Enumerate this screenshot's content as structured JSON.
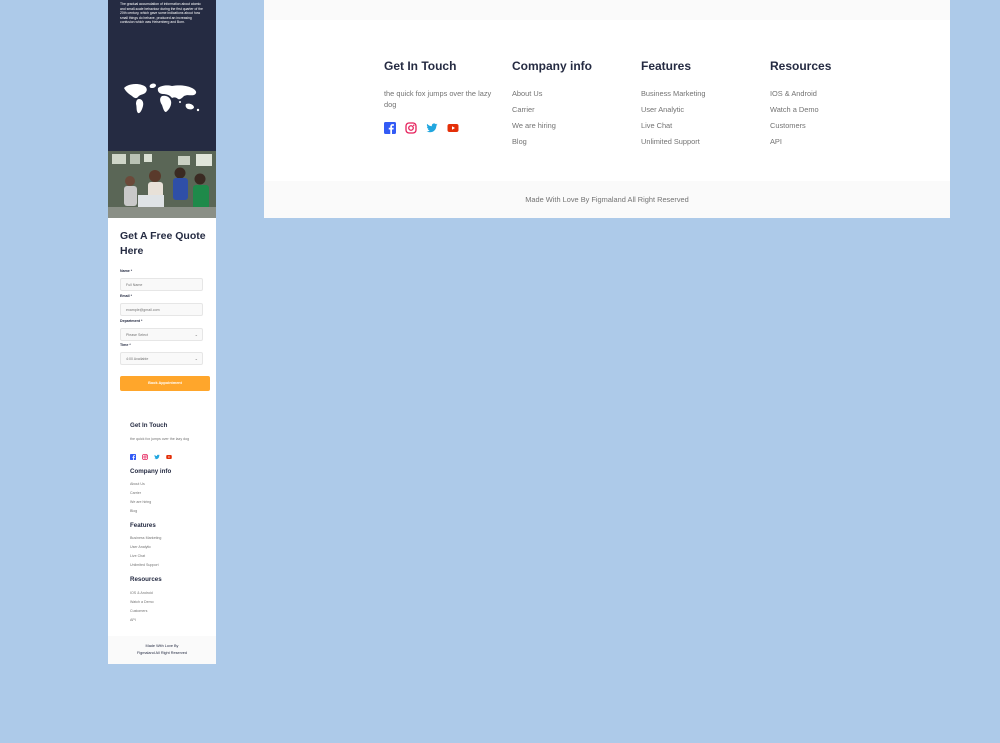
{
  "mobile": {
    "hero_text": "The gradual accumulation of information about atomic and small-scale behaviour during the first quarter of the 20th century, which gave some indications about how small things do behave, produced an increasing confusion which was Heisenberg and Born.",
    "quote": {
      "title": "Get A Free Quote Here",
      "name_label": "Name *",
      "name_placeholder": "Full Name",
      "email_label": "Email *",
      "email_placeholder": "example@gmail.com",
      "department_label": "Department *",
      "department_value": "Please Select",
      "time_label": "Time *",
      "time_value": "4:00 Available",
      "submit_label": "Book Appointment"
    },
    "bottom_text_1": "Made With Love By",
    "bottom_text_2": "Figmaland All Right Reserved"
  },
  "footer": {
    "get_in_touch": {
      "title": "Get In Touch",
      "tagline": "the quick fox jumps over the lazy dog",
      "social": [
        "facebook-icon",
        "instagram-icon",
        "twitter-icon",
        "youtube-icon"
      ]
    },
    "company": {
      "title": "Company info",
      "links": [
        "About Us",
        "Carrier",
        "We are hiring",
        "Blog"
      ]
    },
    "features": {
      "title": "Features",
      "links": [
        "Business Marketing",
        "User Analytic",
        "Live Chat",
        "Unlimited Support"
      ]
    },
    "resources": {
      "title": "Resources",
      "links": [
        "IOS & Android",
        "Watch a Demo",
        "Customers",
        "API"
      ]
    },
    "copyright": "Made With Love By Figmaland All Right Reserved"
  },
  "colors": {
    "background": "#adcae9",
    "navy": "#252b42",
    "accent_orange": "#ffa62b",
    "muted_text": "#737373",
    "facebook": "#335bf5",
    "instagram": "#e51f5a",
    "twitter": "#21a6df",
    "youtube": "#e42f08"
  }
}
